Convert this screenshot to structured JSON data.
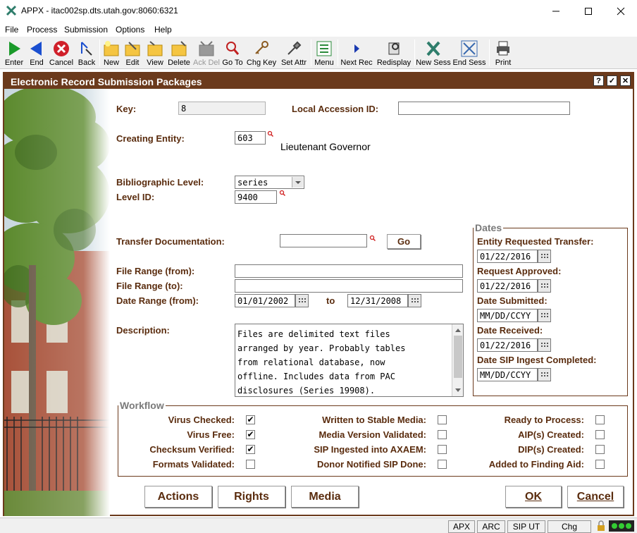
{
  "window": {
    "title": "APPX - itac002sp.dts.utah.gov:8060:6321"
  },
  "menu": [
    "File",
    "Process",
    "Submission",
    "Options",
    "Help"
  ],
  "toolbar": {
    "enter": "Enter",
    "end": "End",
    "cancel": "Cancel",
    "back": "Back",
    "new": "New",
    "edit": "Edit",
    "view": "View",
    "delete": "Delete",
    "ackdel": "Ack Del",
    "goto": "Go To",
    "chgkey": "Chg Key",
    "setattr": "Set Attr",
    "menu": "Menu",
    "nextrec": "Next Rec",
    "redisplay": "Redisplay",
    "newsess": "New Sess",
    "endsess": "End Sess",
    "print": "Print"
  },
  "form": {
    "title": "Electronic Record Submission Packages",
    "help_btn": "?",
    "ok_btn": "✓",
    "close_btn": "✕",
    "key_label": "Key:",
    "key_value": "8",
    "local_accession_label": "Local Accession ID:",
    "local_accession_value": "",
    "creating_entity_label": "Creating Entity:",
    "creating_entity_value": "603",
    "creating_entity_name": "Lieutenant Governor",
    "bib_level_label": "Bibliographic Level:",
    "bib_level_value": "series",
    "level_id_label": "Level ID:",
    "level_id_value": "9400",
    "transfer_doc_label": "Transfer Documentation:",
    "transfer_doc_value": "",
    "go_label": "Go",
    "file_range_from_label": "File Range (from):",
    "file_range_from_value": "",
    "file_range_to_label": "File Range (to):",
    "file_range_to_value": "",
    "date_range_label": "Date Range (from):",
    "date_from": "01/01/2002",
    "to_label": "to",
    "date_to": "12/31/2008",
    "description_label": "Description:",
    "description_lines": [
      "Files are delimited text files",
      "arranged by year. Probably tables",
      "from relational database, now",
      "offline. Includes data from PAC",
      "disclosures (Series 19908)."
    ]
  },
  "dates": {
    "legend": "Dates",
    "entity_requested_label": "Entity Requested Transfer:",
    "entity_requested_value": "01/22/2016",
    "request_approved_label": "Request Approved:",
    "request_approved_value": "01/22/2016",
    "date_submitted_label": "Date Submitted:",
    "date_submitted_value": "MM/DD/CCYY",
    "date_received_label": "Date Received:",
    "date_received_value": "01/22/2016",
    "sip_ingest_label": "Date SIP Ingest Completed:",
    "sip_ingest_value": "MM/DD/CCYY"
  },
  "workflow": {
    "legend": "Workflow",
    "items": [
      {
        "label": "Virus Checked:",
        "checked": true
      },
      {
        "label": "Virus Free:",
        "checked": true
      },
      {
        "label": "Checksum Verified:",
        "checked": true
      },
      {
        "label": "Formats Validated:",
        "checked": false
      },
      {
        "label": "Written to Stable Media:",
        "checked": false
      },
      {
        "label": "Media Version Validated:",
        "checked": false
      },
      {
        "label": "SIP Ingested into AXAEM:",
        "checked": false
      },
      {
        "label": "Donor Notified SIP Done:",
        "checked": false
      },
      {
        "label": "Ready to Process:",
        "checked": false
      },
      {
        "label": "AIP(s) Created:",
        "checked": false
      },
      {
        "label": "DIP(s) Created:",
        "checked": false
      },
      {
        "label": "Added to Finding Aid:",
        "checked": false
      }
    ]
  },
  "buttons": {
    "actions": "Actions",
    "rights": "Rights",
    "media": "Media",
    "ok": "OK",
    "cancel": "Cancel"
  },
  "status": {
    "apx": "APX",
    "arc": "ARC",
    "sipu": "SIP UT",
    "chg": "Chg"
  },
  "colors": {
    "frame": "#6b3a1c",
    "label": "#5a2c0e"
  }
}
